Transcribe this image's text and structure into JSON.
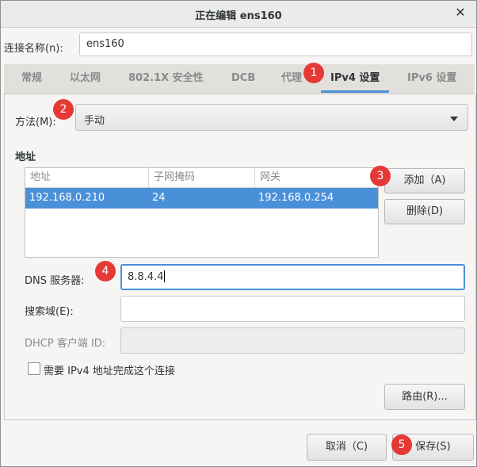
{
  "window": {
    "title": "正在编辑 ens160",
    "close_glyph": "✕"
  },
  "connection": {
    "name_label": "连接名称(n):",
    "name_value": "ens160"
  },
  "tabs": [
    {
      "label": "常规"
    },
    {
      "label": "以太网"
    },
    {
      "label": "802.1X 安全性"
    },
    {
      "label": "DCB"
    },
    {
      "label": "代理"
    },
    {
      "label": "IPv4 设置"
    },
    {
      "label": "IPv6 设置"
    }
  ],
  "active_tab": "IPv4 设置",
  "ipv4": {
    "method_label": "方法(M):",
    "method_value": "手动",
    "address_heading": "地址",
    "columns": [
      "地址",
      "子网掩码",
      "网关"
    ],
    "rows": [
      {
        "address": "192.168.0.210",
        "netmask": "24",
        "gateway": "192.168.0.254"
      }
    ],
    "add_button": "添加（A)",
    "delete_button": "删除(D)",
    "dns_label": "DNS 服务器:",
    "dns_value": "8.8.4.4",
    "search_label": "搜索域(E):",
    "search_value": "",
    "dhcp_label": "DHCP 客户端 ID:",
    "dhcp_value": "",
    "require_label": "需要 IPv4 地址完成这个连接",
    "require_checked": false,
    "routes_button": "路由(R)..."
  },
  "footer": {
    "cancel_button": "取消（C)",
    "save_button": "保存(S)"
  },
  "markers": [
    "1",
    "2",
    "3",
    "4",
    "5"
  ],
  "colors": {
    "accent": "#4a90d9",
    "marker": "#e53935"
  },
  "icons": {
    "dropdown": "chevron-down-icon",
    "close": "close-icon"
  }
}
